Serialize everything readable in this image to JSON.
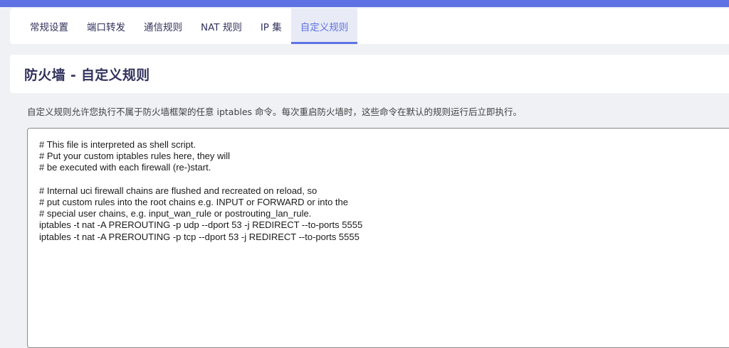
{
  "tabs": [
    {
      "label": "常规设置",
      "active": false
    },
    {
      "label": "端口转发",
      "active": false
    },
    {
      "label": "通信规则",
      "active": false
    },
    {
      "label": "NAT 规则",
      "active": false
    },
    {
      "label": "IP 集",
      "active": false
    },
    {
      "label": "自定义规则",
      "active": true
    }
  ],
  "page": {
    "title": "防火墙 - 自定义规则",
    "description": "自定义规则允许您执行不属于防火墙框架的任意 iptables 命令。每次重启防火墙时，这些命令在默认的规则运行后立即执行。"
  },
  "editor": {
    "content": "# This file is interpreted as shell script.\n# Put your custom iptables rules here, they will\n# be executed with each firewall (re-)start.\n\n# Internal uci firewall chains are flushed and recreated on reload, so\n# put custom rules into the root chains e.g. INPUT or FORWARD or into the\n# special user chains, e.g. input_wan_rule or postrouting_lan_rule.\niptables -t nat -A PREROUTING -p udp --dport 53 -j REDIRECT --to-ports 5555\niptables -t nat -A PREROUTING -p tcp --dport 53 -j REDIRECT --to-ports 5555"
  },
  "colors": {
    "accent": "#5e72e4",
    "background": "#f0f1f5",
    "text": "#32325d"
  }
}
